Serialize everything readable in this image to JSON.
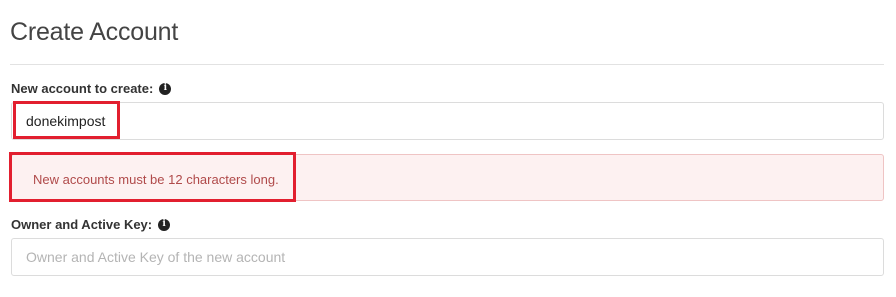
{
  "page": {
    "title": "Create Account"
  },
  "new_account": {
    "label": "New account to create:",
    "info_icon": "info-icon",
    "value": "donekimpost"
  },
  "error": {
    "message": "New accounts must be 12 characters long."
  },
  "owner_key": {
    "label": "Owner and Active Key:",
    "info_icon": "info-icon",
    "value": "",
    "placeholder": "Owner and Active Key of the new account"
  },
  "colors": {
    "highlight": "#e21f2f",
    "error_bg": "#fdf1f1",
    "error_text": "#b04a4a"
  }
}
